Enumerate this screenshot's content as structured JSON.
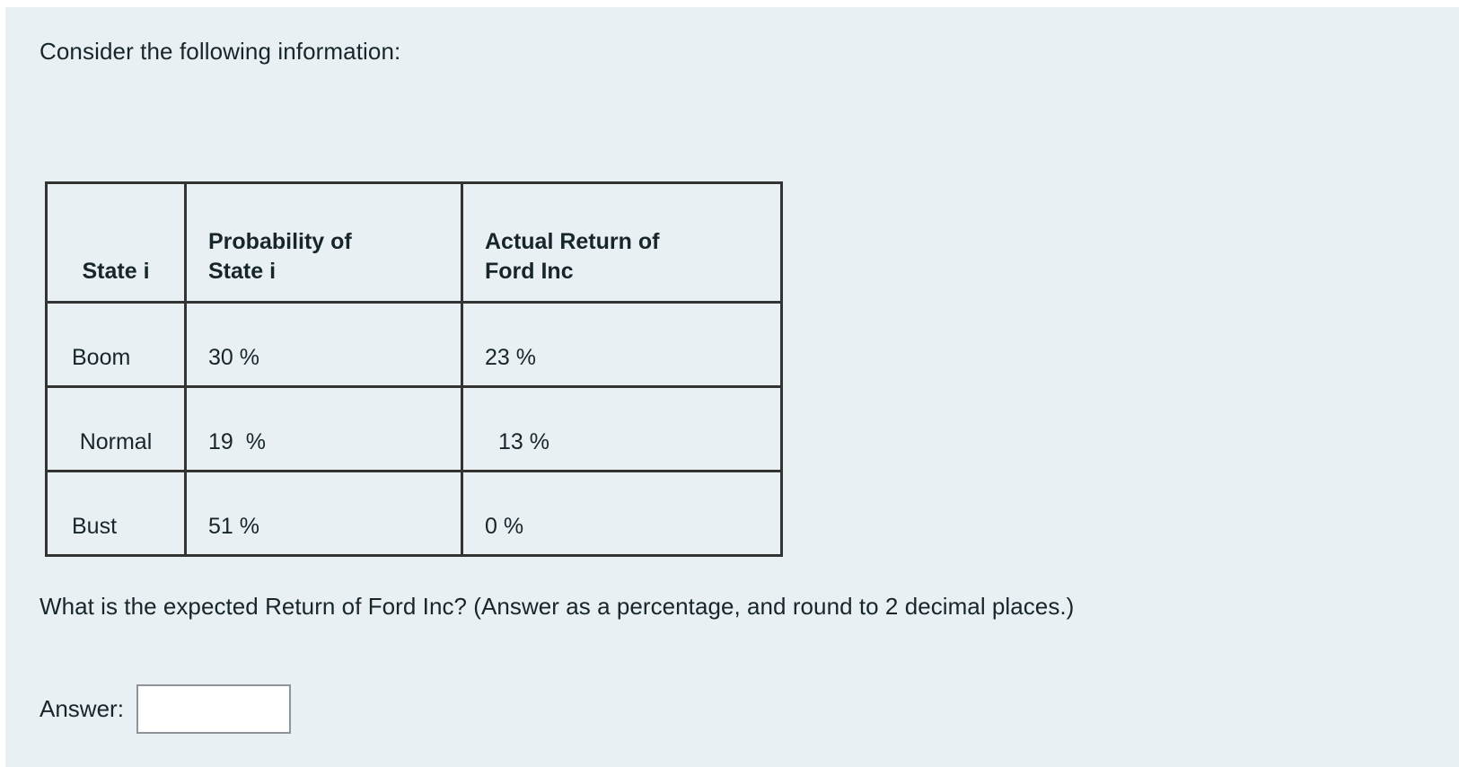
{
  "page": {
    "background_color": "#e9f0f3",
    "text_color": "#17262b",
    "intro": "Consider the following information:",
    "question": "What is the expected Return of Ford Inc? (Answer as a percentage, and round to 2 decimal places.)"
  },
  "table": {
    "border_color": "#333333",
    "headers": {
      "col1": "State i",
      "col2_line1": "Probability of",
      "col2_line2": "State i",
      "col3_line1": "Actual Return of",
      "col3_line2": "Ford Inc"
    },
    "rows": [
      {
        "state": "Boom",
        "probability": "30 %",
        "actual_return": "23 %"
      },
      {
        "state": "Normal",
        "probability": "19  %",
        "actual_return": " 13 %"
      },
      {
        "state": "Bust",
        "probability": "51 %",
        "actual_return": "0 %"
      }
    ]
  },
  "answer": {
    "label": "Answer:",
    "value": "",
    "placeholder": ""
  },
  "chart_data": {
    "type": "table",
    "title": "Probability and Actual Return of Ford Inc by State",
    "columns": [
      "State i",
      "Probability of State i",
      "Actual Return of Ford Inc"
    ],
    "rows": [
      [
        "Boom",
        30,
        23
      ],
      [
        "Normal",
        19,
        13
      ],
      [
        "Bust",
        51,
        0
      ]
    ],
    "units": "percent"
  }
}
